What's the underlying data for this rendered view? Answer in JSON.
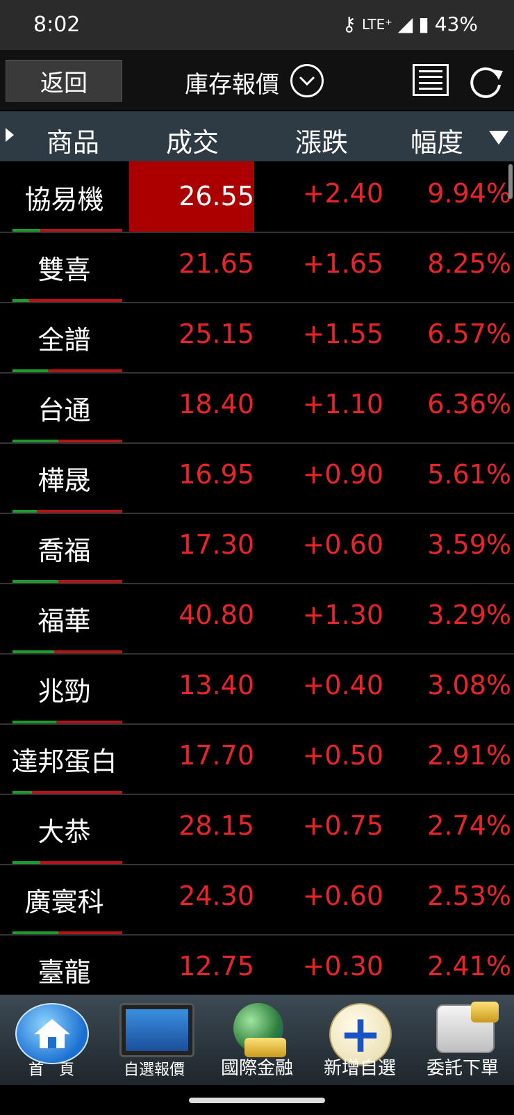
{
  "status": {
    "time": "8:02",
    "network": "LTE⁺",
    "battery": "43%"
  },
  "header": {
    "back_label": "返回",
    "title": "庫存報價"
  },
  "columns": {
    "product": "商品",
    "price": "成交",
    "change": "漲跌",
    "percent": "幅度"
  },
  "rows": [
    {
      "name": "協易機",
      "price": "26.55",
      "change": "+2.40",
      "percent": "9.94%",
      "bar_green": 0.25
    },
    {
      "name": "雙喜",
      "price": "21.65",
      "change": "+1.65",
      "percent": "8.25%",
      "bar_green": 0.15
    },
    {
      "name": "全譜",
      "price": "25.15",
      "change": "+1.55",
      "percent": "6.57%",
      "bar_green": 0.32
    },
    {
      "name": "台通",
      "price": "18.40",
      "change": "+1.10",
      "percent": "6.36%",
      "bar_green": 0.42
    },
    {
      "name": "樺晟",
      "price": "16.95",
      "change": "+0.90",
      "percent": "5.61%",
      "bar_green": 0.22
    },
    {
      "name": "喬福",
      "price": "17.30",
      "change": "+0.60",
      "percent": "3.59%",
      "bar_green": 0.42
    },
    {
      "name": "福華",
      "price": "40.80",
      "change": "+1.30",
      "percent": "3.29%",
      "bar_green": 0.38
    },
    {
      "name": "兆勁",
      "price": "13.40",
      "change": "+0.40",
      "percent": "3.08%",
      "bar_green": 0.4
    },
    {
      "name": "達邦蛋白",
      "price": "17.70",
      "change": "+0.50",
      "percent": "2.91%",
      "bar_green": 0.18
    },
    {
      "name": "大恭",
      "price": "28.15",
      "change": "+0.75",
      "percent": "2.74%",
      "bar_green": 0.25
    },
    {
      "name": "廣寰科",
      "price": "24.30",
      "change": "+0.60",
      "percent": "2.53%",
      "bar_green": 0.42
    },
    {
      "name": "臺龍",
      "price": "12.75",
      "change": "+0.30",
      "percent": "2.41%",
      "bar_green": 0.3
    }
  ],
  "nav": {
    "home": "首　頁",
    "watchlist": "自選報價",
    "intl": "國際金融",
    "add": "新增自選",
    "order": "委託下單"
  }
}
